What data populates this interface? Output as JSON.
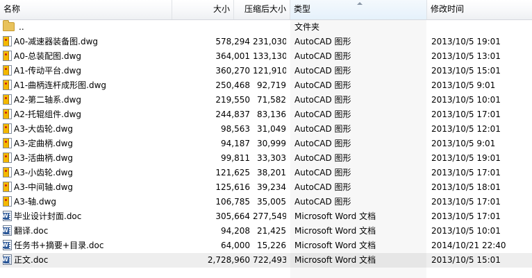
{
  "columns": {
    "name": "名称",
    "size": "大小",
    "compressed": "压缩后大小",
    "type": "类型",
    "modified": "修改时间"
  },
  "rows": [
    {
      "icon": "folder",
      "name": "..",
      "size": "",
      "compressed": "",
      "type": "文件夹",
      "modified": ""
    },
    {
      "icon": "dwg",
      "name": "A0-减速器装备图.dwg",
      "size": "578,294",
      "compressed": "231,030",
      "type": "AutoCAD 图形",
      "modified": "2013/10/5 19:01"
    },
    {
      "icon": "dwg",
      "name": "A0-总装配图.dwg",
      "size": "364,001",
      "compressed": "133,130",
      "type": "AutoCAD 图形",
      "modified": "2013/10/5 13:01"
    },
    {
      "icon": "dwg",
      "name": "A1-传动平台.dwg",
      "size": "360,270",
      "compressed": "121,910",
      "type": "AutoCAD 图形",
      "modified": "2013/10/5 15:01"
    },
    {
      "icon": "dwg",
      "name": "A1-曲柄连杆成形图.dwg",
      "size": "250,468",
      "compressed": "92,719",
      "type": "AutoCAD 图形",
      "modified": "2013/10/5 9:01"
    },
    {
      "icon": "dwg",
      "name": "A2-第二轴系.dwg",
      "size": "219,550",
      "compressed": "71,582",
      "type": "AutoCAD 图形",
      "modified": "2013/10/5 10:01"
    },
    {
      "icon": "dwg",
      "name": "A2-托辊组件.dwg",
      "size": "244,837",
      "compressed": "83,136",
      "type": "AutoCAD 图形",
      "modified": "2013/10/5 17:01"
    },
    {
      "icon": "dwg",
      "name": "A3-大齿轮.dwg",
      "size": "98,563",
      "compressed": "31,049",
      "type": "AutoCAD 图形",
      "modified": "2013/10/5 12:01"
    },
    {
      "icon": "dwg",
      "name": "A3-定曲柄.dwg",
      "size": "94,187",
      "compressed": "30,999",
      "type": "AutoCAD 图形",
      "modified": "2013/10/5 9:01"
    },
    {
      "icon": "dwg",
      "name": "A3-活曲柄.dwg",
      "size": "99,811",
      "compressed": "33,303",
      "type": "AutoCAD 图形",
      "modified": "2013/10/5 19:01"
    },
    {
      "icon": "dwg",
      "name": "A3-小齿轮.dwg",
      "size": "121,625",
      "compressed": "38,201",
      "type": "AutoCAD 图形",
      "modified": "2013/10/5 17:01"
    },
    {
      "icon": "dwg",
      "name": "A3-中间轴.dwg",
      "size": "125,616",
      "compressed": "39,234",
      "type": "AutoCAD 图形",
      "modified": "2013/10/5 18:01"
    },
    {
      "icon": "dwg",
      "name": "A3-轴.dwg",
      "size": "106,785",
      "compressed": "35,005",
      "type": "AutoCAD 图形",
      "modified": "2013/10/5 17:01"
    },
    {
      "icon": "doc",
      "name": "毕业设计封面.doc",
      "size": "305,664",
      "compressed": "277,549",
      "type": "Microsoft Word 文档",
      "modified": "2013/10/5 17:01"
    },
    {
      "icon": "doc",
      "name": "翻译.doc",
      "size": "94,208",
      "compressed": "21,425",
      "type": "Microsoft Word 文档",
      "modified": "2013/10/5 10:01"
    },
    {
      "icon": "doc",
      "name": "任务书+摘要+目录.doc",
      "size": "64,000",
      "compressed": "15,226",
      "type": "Microsoft Word 文档",
      "modified": "2014/10/21 22:40"
    },
    {
      "icon": "doc",
      "name": "正文.doc",
      "size": "2,728,960",
      "compressed": "722,493",
      "type": "Microsoft Word 文档",
      "modified": "2013/10/5 15:01",
      "selected": true
    }
  ]
}
